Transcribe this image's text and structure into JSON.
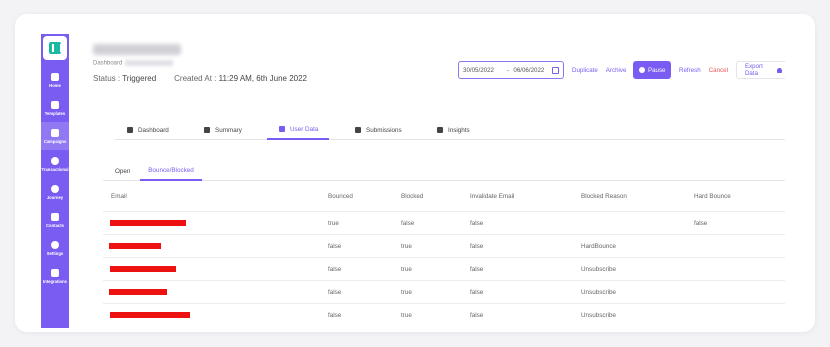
{
  "header": {
    "breadcrumb_label": "Dashboard",
    "status_label": "Status : ",
    "status_value": "Triggered",
    "created_label": "Created At : ",
    "created_value": "11:29 AM, 6th June 2022"
  },
  "toolbar": {
    "date_from": "30/05/2022",
    "date_sep": "→",
    "date_to": "06/06/2022",
    "duplicate": "Duplicate",
    "archive": "Archive",
    "pause": "Pause",
    "refresh": "Refresh",
    "cancel": "Cancel",
    "export": "Export Data"
  },
  "sidebar": {
    "items": [
      {
        "label": "Home",
        "icon": "grid-icon"
      },
      {
        "label": "Templates",
        "icon": "document-icon"
      },
      {
        "label": "Campaigns",
        "icon": "megaphone-icon"
      },
      {
        "label": "Transactional",
        "icon": "transfer-icon"
      },
      {
        "label": "Journey",
        "icon": "journey-icon"
      },
      {
        "label": "Contacts",
        "icon": "users-icon"
      },
      {
        "label": "Settings",
        "icon": "gear-icon"
      },
      {
        "label": "Integrations",
        "icon": "plug-icon"
      }
    ]
  },
  "tabs": [
    "Dashboard",
    "Summary",
    "User Data",
    "Submissions",
    "Insights"
  ],
  "active_tab": "User Data",
  "subtabs": [
    "Open",
    "Bounce/Blocked"
  ],
  "active_subtab": "Bounce/Blocked",
  "table": {
    "columns": [
      "Email",
      "Bounced",
      "Blocked",
      "Invalidate Email",
      "Blocked Reason",
      "Hard Bounce"
    ],
    "rows": [
      {
        "bounced": "true",
        "blocked": "false",
        "invalid": "false",
        "reason": "",
        "hard": "false"
      },
      {
        "bounced": "false",
        "blocked": "true",
        "invalid": "false",
        "reason": "HardBounce",
        "hard": ""
      },
      {
        "bounced": "false",
        "blocked": "true",
        "invalid": "false",
        "reason": "Unsubscribe",
        "hard": ""
      },
      {
        "bounced": "false",
        "blocked": "true",
        "invalid": "false",
        "reason": "Unsubscribe",
        "hard": ""
      },
      {
        "bounced": "false",
        "blocked": "true",
        "invalid": "false",
        "reason": "Unsubscribe",
        "hard": ""
      }
    ]
  },
  "colors": {
    "accent": "#7b5cf2",
    "danger": "#e55555",
    "redaction": "#ee1111"
  }
}
